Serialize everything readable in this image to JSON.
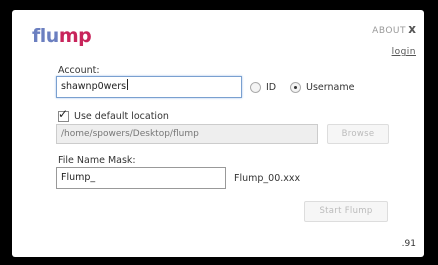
{
  "app": {
    "logo_part1": "flu",
    "logo_part2": "mp"
  },
  "header": {
    "about_label": "ABOUT",
    "close_glyph": "x",
    "login_label": "login"
  },
  "account": {
    "label": "Account:",
    "value": "shawnp0wers",
    "radio_id_label": "ID",
    "radio_username_label": "Username",
    "selected_radio": "Username"
  },
  "location": {
    "checkbox_label": "Use default location",
    "checked": true,
    "path": "/home/spowers/Desktop/flump",
    "browse_label": "Browse"
  },
  "mask": {
    "label": "File Name Mask:",
    "value": "Flump_",
    "preview": "Flump_00.xxx"
  },
  "actions": {
    "start_label": "Start Flump"
  },
  "footer": {
    "version": ".91"
  }
}
